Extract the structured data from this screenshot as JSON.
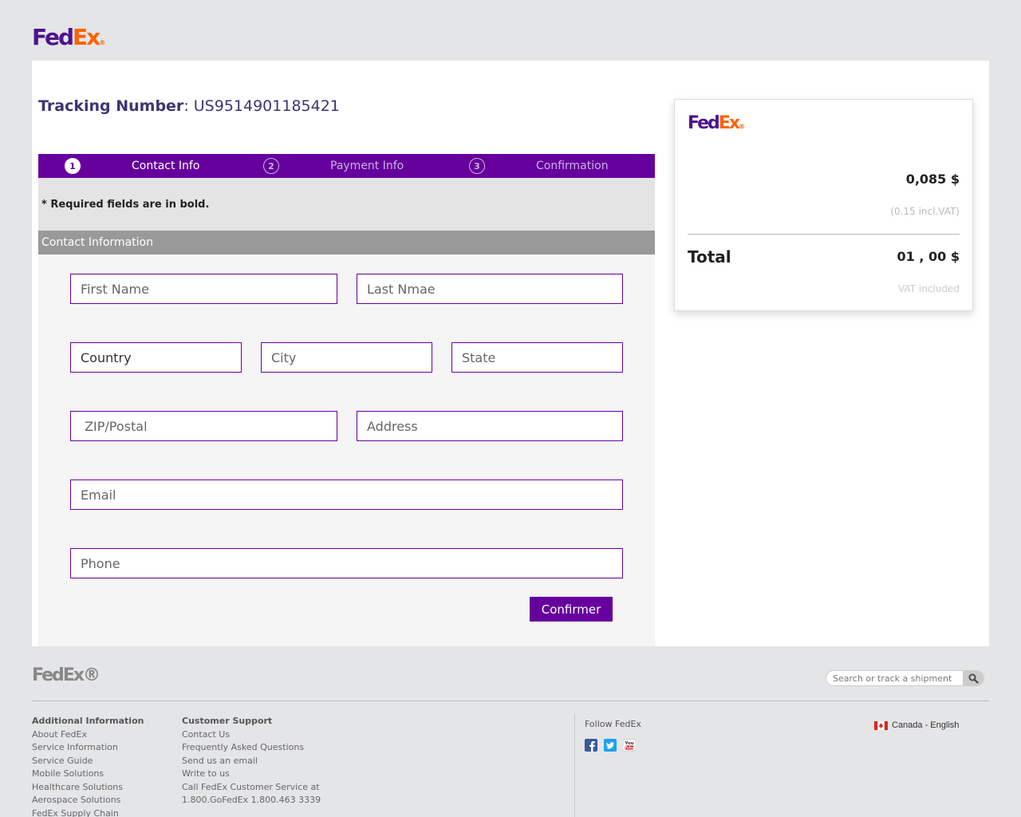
{
  "header": {
    "logo": {
      "fed": "Fed",
      "ex": "Ex",
      "dot": "®"
    }
  },
  "tracking": {
    "label": "Tracking Number",
    "separator": ": ",
    "number": "US9514901185421"
  },
  "steps": [
    {
      "num": "1",
      "label": "Contact Info",
      "active": true
    },
    {
      "num": "2",
      "label": "Payment Info",
      "active": false
    },
    {
      "num": "3",
      "label": "Confirmation",
      "active": false
    }
  ],
  "form": {
    "required_note": "* Required fields are in bold.",
    "section_title": "Contact Information",
    "fields": {
      "first_name": {
        "placeholder": "First Name",
        "value": ""
      },
      "last_name": {
        "placeholder": "Last Nmae",
        "value": ""
      },
      "country": {
        "placeholder": "Country",
        "value": "Country"
      },
      "city": {
        "placeholder": "City",
        "value": ""
      },
      "state": {
        "placeholder": "State",
        "value": ""
      },
      "zip": {
        "placeholder": " ZIP/Postal",
        "value": ""
      },
      "address": {
        "placeholder": "Address",
        "value": ""
      },
      "email": {
        "placeholder": "Email",
        "value": ""
      },
      "phone": {
        "placeholder": "Phone",
        "value": ""
      }
    },
    "confirm_label": "Confirmer"
  },
  "summary": {
    "price": "0,085 $",
    "vat_note": "(0.15 incl.VAT)",
    "total_label": "Total",
    "total_value": "01 , 00 $",
    "vat_included": "VAT included"
  },
  "footer": {
    "search_placeholder": "Search or track a shipment",
    "col1": {
      "title": "Additional Information",
      "links": [
        "About FedEx",
        "Service Information",
        "Service Guide",
        "Mobile Solutions",
        "Healthcare Solutions",
        "Aerospace Solutions",
        "FedEx Supply Chain"
      ]
    },
    "col2": {
      "title": "Customer Support",
      "links": [
        "Contact Us",
        "Frequently Asked Questions",
        "Send us an email",
        "Write to us",
        "Call FedEx Customer Service at",
        "1.800.GoFedEx 1.800.463 3339"
      ]
    },
    "follow_label": "Follow FedEx",
    "locale": "Canada - English"
  },
  "colors": {
    "brand_purple": "#4d148c",
    "brand_orange": "#ff6200",
    "step_bar": "#66009d"
  }
}
